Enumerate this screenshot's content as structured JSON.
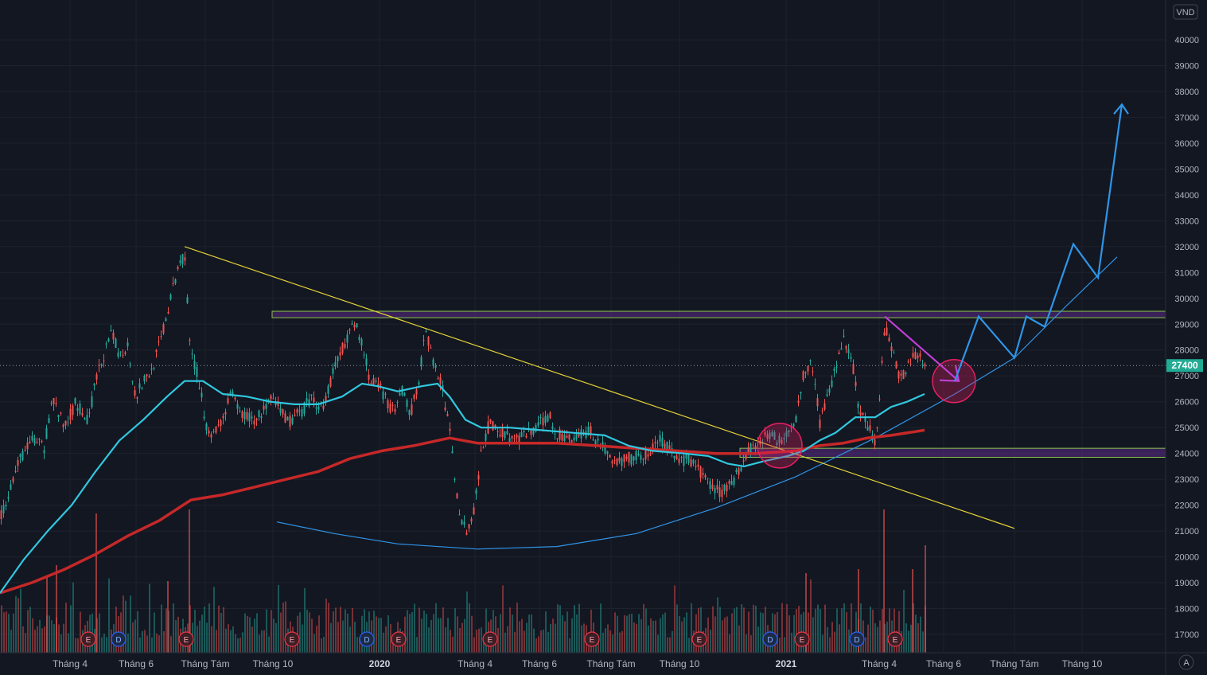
{
  "currency_label": "VND",
  "auto_scale_label": "A",
  "last_price_label": "27400",
  "colors": {
    "background": "#131722",
    "grid": "#1e222d",
    "up": "#26a69a",
    "down": "#ef5350",
    "ma_fast": "#31c8e0",
    "ma_slow": "#c62828",
    "trendline": "#e3d337",
    "zone": "#5b2a86",
    "zone_border": "#8bc34a",
    "projection": "#2f95e8",
    "target_arrow": "#c03fd6",
    "circle": "#e91e63",
    "last_price": "#22ab94"
  },
  "chart_data": {
    "type": "candlestick",
    "symbol_currency": "VND",
    "ylim": [
      16600,
      41000
    ],
    "y_ticks": [
      17000,
      18000,
      19000,
      20000,
      21000,
      22000,
      23000,
      24000,
      25000,
      26000,
      27000,
      28000,
      29000,
      30000,
      31000,
      32000,
      33000,
      34000,
      35000,
      36000,
      37000,
      38000,
      39000,
      40000
    ],
    "x_ticks": [
      {
        "label": "Tháng 4",
        "bold": false
      },
      {
        "label": "Tháng 6",
        "bold": false
      },
      {
        "label": "Tháng Tám",
        "bold": false
      },
      {
        "label": "Tháng 10",
        "bold": false
      },
      {
        "label": "2020",
        "bold": true
      },
      {
        "label": "Tháng 4",
        "bold": false
      },
      {
        "label": "Tháng 6",
        "bold": false
      },
      {
        "label": "Tháng Tám",
        "bold": false
      },
      {
        "label": "Tháng 10",
        "bold": false
      },
      {
        "label": "2021",
        "bold": true
      },
      {
        "label": "Tháng 4",
        "bold": false
      },
      {
        "label": "Tháng 6",
        "bold": false
      },
      {
        "label": "Tháng Tám",
        "bold": false
      },
      {
        "label": "Tháng 10",
        "bold": false
      }
    ],
    "last_price": 27400,
    "price_path": [
      [
        0,
        21500
      ],
      [
        10,
        22500
      ],
      [
        25,
        23800
      ],
      [
        40,
        24500
      ],
      [
        55,
        24200
      ],
      [
        65,
        26200
      ],
      [
        80,
        25000
      ],
      [
        95,
        26000
      ],
      [
        110,
        25200
      ],
      [
        120,
        26800
      ],
      [
        130,
        27800
      ],
      [
        140,
        28600
      ],
      [
        150,
        27800
      ],
      [
        160,
        28200
      ],
      [
        170,
        26200
      ],
      [
        180,
        26800
      ],
      [
        190,
        27200
      ],
      [
        200,
        28200
      ],
      [
        212,
        29700
      ],
      [
        225,
        31400
      ],
      [
        232,
        31700
      ],
      [
        238,
        28200
      ],
      [
        248,
        27000
      ],
      [
        258,
        25200
      ],
      [
        268,
        24700
      ],
      [
        280,
        25400
      ],
      [
        290,
        26300
      ],
      [
        300,
        25600
      ],
      [
        320,
        25300
      ],
      [
        340,
        26000
      ],
      [
        350,
        25800
      ],
      [
        360,
        25200
      ],
      [
        375,
        25500
      ],
      [
        390,
        26100
      ],
      [
        405,
        25800
      ],
      [
        420,
        27300
      ],
      [
        435,
        28500
      ],
      [
        447,
        29000
      ],
      [
        455,
        28200
      ],
      [
        465,
        26800
      ],
      [
        480,
        26400
      ],
      [
        495,
        25500
      ],
      [
        505,
        26400
      ],
      [
        515,
        25500
      ],
      [
        525,
        26700
      ],
      [
        535,
        28800
      ],
      [
        545,
        27400
      ],
      [
        555,
        26600
      ],
      [
        565,
        24800
      ],
      [
        575,
        22000
      ],
      [
        585,
        21000
      ],
      [
        595,
        21700
      ],
      [
        605,
        24200
      ],
      [
        615,
        25200
      ],
      [
        630,
        24800
      ],
      [
        650,
        24500
      ],
      [
        670,
        24900
      ],
      [
        690,
        25500
      ],
      [
        700,
        24700
      ],
      [
        720,
        24600
      ],
      [
        740,
        24900
      ],
      [
        755,
        24300
      ],
      [
        770,
        23700
      ],
      [
        790,
        23800
      ],
      [
        810,
        23900
      ],
      [
        830,
        24500
      ],
      [
        850,
        23800
      ],
      [
        870,
        23700
      ],
      [
        890,
        22800
      ],
      [
        905,
        22500
      ],
      [
        920,
        22900
      ],
      [
        940,
        24100
      ],
      [
        960,
        24700
      ],
      [
        980,
        24500
      ],
      [
        1000,
        25400
      ],
      [
        1010,
        27100
      ],
      [
        1020,
        27600
      ],
      [
        1030,
        25200
      ],
      [
        1040,
        26300
      ],
      [
        1050,
        27300
      ],
      [
        1060,
        28400
      ],
      [
        1070,
        27700
      ],
      [
        1080,
        25500
      ],
      [
        1090,
        25100
      ],
      [
        1100,
        24500
      ],
      [
        1112,
        28900
      ],
      [
        1120,
        28000
      ],
      [
        1130,
        26900
      ],
      [
        1140,
        27300
      ],
      [
        1150,
        27900
      ],
      [
        1162,
        27400
      ]
    ],
    "volume_spikes": [
      {
        "x": 237,
        "h": 180
      },
      {
        "x": 70,
        "h": 110
      },
      {
        "x": 120,
        "h": 175
      },
      {
        "x": 1110,
        "h": 180
      },
      {
        "x": 1162,
        "h": 135
      },
      {
        "x": 1012,
        "h": 100
      },
      {
        "x": 1078,
        "h": 105
      },
      {
        "x": 1146,
        "h": 105
      },
      {
        "x": 58,
        "h": 95
      },
      {
        "x": 210,
        "h": 90
      }
    ],
    "ma_fast": [
      [
        0,
        18600
      ],
      [
        30,
        19900
      ],
      [
        60,
        21000
      ],
      [
        90,
        22000
      ],
      [
        120,
        23300
      ],
      [
        150,
        24500
      ],
      [
        180,
        25300
      ],
      [
        210,
        26200
      ],
      [
        232,
        26800
      ],
      [
        255,
        26800
      ],
      [
        280,
        26300
      ],
      [
        310,
        26200
      ],
      [
        340,
        26000
      ],
      [
        370,
        25900
      ],
      [
        400,
        25900
      ],
      [
        430,
        26200
      ],
      [
        455,
        26700
      ],
      [
        475,
        26600
      ],
      [
        500,
        26400
      ],
      [
        530,
        26600
      ],
      [
        550,
        26700
      ],
      [
        565,
        26200
      ],
      [
        585,
        25300
      ],
      [
        605,
        25000
      ],
      [
        640,
        25000
      ],
      [
        680,
        24900
      ],
      [
        720,
        24800
      ],
      [
        760,
        24700
      ],
      [
        790,
        24300
      ],
      [
        820,
        24100
      ],
      [
        860,
        24000
      ],
      [
        890,
        23900
      ],
      [
        915,
        23600
      ],
      [
        935,
        23500
      ],
      [
        960,
        23700
      ],
      [
        990,
        23900
      ],
      [
        1010,
        24100
      ],
      [
        1030,
        24500
      ],
      [
        1050,
        24800
      ],
      [
        1075,
        25400
      ],
      [
        1100,
        25400
      ],
      [
        1120,
        25800
      ],
      [
        1140,
        26000
      ],
      [
        1162,
        26300
      ]
    ],
    "ma_slow": [
      [
        0,
        18600
      ],
      [
        40,
        19000
      ],
      [
        80,
        19500
      ],
      [
        120,
        20100
      ],
      [
        160,
        20800
      ],
      [
        200,
        21400
      ],
      [
        240,
        22200
      ],
      [
        280,
        22400
      ],
      [
        320,
        22700
      ],
      [
        360,
        23000
      ],
      [
        400,
        23300
      ],
      [
        440,
        23800
      ],
      [
        480,
        24100
      ],
      [
        520,
        24300
      ],
      [
        565,
        24600
      ],
      [
        600,
        24400
      ],
      [
        650,
        24400
      ],
      [
        700,
        24400
      ],
      [
        750,
        24300
      ],
      [
        800,
        24200
      ],
      [
        850,
        24100
      ],
      [
        900,
        24000
      ],
      [
        950,
        24000
      ],
      [
        1000,
        24100
      ],
      [
        1030,
        24300
      ],
      [
        1060,
        24400
      ],
      [
        1090,
        24600
      ],
      [
        1120,
        24700
      ],
      [
        1162,
        24900
      ]
    ],
    "trendline": [
      [
        232,
        32000
      ],
      [
        1275,
        21100
      ]
    ],
    "resistance_zone": {
      "x_from": 342,
      "x_to": 1465,
      "y_high": 29500,
      "y_low": 29250
    },
    "support_zone": {
      "x_from": 930,
      "x_to": 1465,
      "y_high": 24200,
      "y_low": 23850
    },
    "rounding_bottom_arc": [
      [
        348,
        21350
      ],
      [
        420,
        20900
      ],
      [
        500,
        20500
      ],
      [
        600,
        20300
      ],
      [
        700,
        20400
      ],
      [
        800,
        20900
      ],
      [
        900,
        21900
      ],
      [
        1000,
        23100
      ],
      [
        1100,
        24600
      ],
      [
        1200,
        26300
      ],
      [
        1275,
        27700
      ],
      [
        1340,
        29700
      ],
      [
        1404,
        31600
      ]
    ],
    "forecast_path": [
      [
        1200,
        26800
      ],
      [
        1230,
        29300
      ],
      [
        1275,
        27700
      ],
      [
        1290,
        29300
      ],
      [
        1313,
        28900
      ],
      [
        1349,
        32100
      ],
      [
        1380,
        30800
      ],
      [
        1410,
        37500
      ]
    ],
    "pullback_arrow": [
      [
        1112,
        29300
      ],
      [
        1205,
        26800
      ]
    ],
    "highlight_circles": [
      {
        "x": 980,
        "y": 24300,
        "r": 28
      },
      {
        "x": 1199,
        "y": 26800,
        "r": 27
      }
    ],
    "event_badges": [
      {
        "x": 111,
        "t": "E"
      },
      {
        "x": 149,
        "t": "D"
      },
      {
        "x": 234,
        "t": "E"
      },
      {
        "x": 367,
        "t": "E"
      },
      {
        "x": 461,
        "t": "D"
      },
      {
        "x": 501,
        "t": "E"
      },
      {
        "x": 616,
        "t": "E"
      },
      {
        "x": 744,
        "t": "E"
      },
      {
        "x": 879,
        "t": "E"
      },
      {
        "x": 968,
        "t": "D"
      },
      {
        "x": 1008,
        "t": "E"
      },
      {
        "x": 1077,
        "t": "D"
      },
      {
        "x": 1125,
        "t": "E"
      }
    ]
  }
}
